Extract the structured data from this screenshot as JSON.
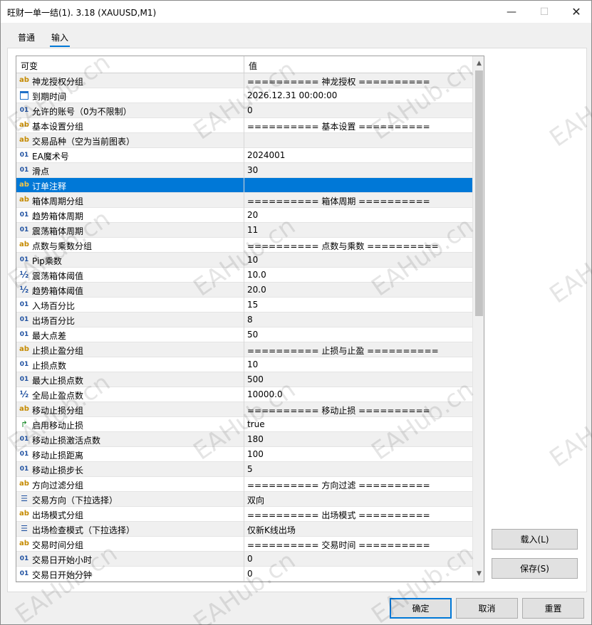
{
  "window": {
    "title": "旺财一单一结(1). 3.18 (XAUUSD,M1)",
    "minimize_glyph": "—",
    "maximize_glyph": "☐",
    "close_glyph": "✕"
  },
  "tabs": [
    {
      "label": "普通",
      "active": false
    },
    {
      "label": "输入",
      "active": true
    }
  ],
  "grid": {
    "col_variable": "可变",
    "col_value": "值",
    "rows": [
      {
        "icon": "ab",
        "name": "神龙授权分组",
        "value": "========== 神龙授权 =========="
      },
      {
        "icon": "calendar",
        "name": "到期时间",
        "value": "2026.12.31 00:00:00"
      },
      {
        "icon": "01",
        "name": "允许的账号（0为不限制）",
        "value": "0"
      },
      {
        "icon": "ab",
        "name": "基本设置分组",
        "value": "========== 基本设置 =========="
      },
      {
        "icon": "ab",
        "name": "交易品种（空为当前图表）",
        "value": ""
      },
      {
        "icon": "01",
        "name": "EA魔术号",
        "value": "2024001"
      },
      {
        "icon": "01",
        "name": "滑点",
        "value": "30"
      },
      {
        "icon": "ab",
        "name": "订单注释",
        "value": "",
        "selected": true
      },
      {
        "icon": "ab",
        "name": "箱体周期分组",
        "value": "========== 箱体周期 =========="
      },
      {
        "icon": "01",
        "name": "趋势箱体周期",
        "value": "20"
      },
      {
        "icon": "01",
        "name": "震荡箱体周期",
        "value": "11"
      },
      {
        "icon": "ab",
        "name": "点数与乘数分组",
        "value": "========== 点数与乘数 =========="
      },
      {
        "icon": "01",
        "name": "Pip乘数",
        "value": "10"
      },
      {
        "icon": "half",
        "name": "震荡箱体阈值",
        "value": "10.0"
      },
      {
        "icon": "half",
        "name": "趋势箱体阈值",
        "value": "20.0"
      },
      {
        "icon": "01",
        "name": "入场百分比",
        "value": "15"
      },
      {
        "icon": "01",
        "name": "出场百分比",
        "value": "8"
      },
      {
        "icon": "01",
        "name": "最大点差",
        "value": "50"
      },
      {
        "icon": "ab",
        "name": "止损止盈分组",
        "value": "========== 止损与止盈 =========="
      },
      {
        "icon": "01",
        "name": "止损点数",
        "value": "10"
      },
      {
        "icon": "01",
        "name": "最大止损点数",
        "value": "500"
      },
      {
        "icon": "half",
        "name": "全局止盈点数",
        "value": "10000.0"
      },
      {
        "icon": "ab",
        "name": "移动止损分组",
        "value": "========== 移动止损 =========="
      },
      {
        "icon": "bool",
        "name": "启用移动止损",
        "value": "true"
      },
      {
        "icon": "01",
        "name": "移动止损激活点数",
        "value": "180"
      },
      {
        "icon": "01",
        "name": "移动止损距离",
        "value": "100"
      },
      {
        "icon": "01",
        "name": "移动止损步长",
        "value": "5"
      },
      {
        "icon": "ab",
        "name": "方向过滤分组",
        "value": "========== 方向过滤 =========="
      },
      {
        "icon": "list",
        "name": "交易方向（下拉选择）",
        "value": "双向"
      },
      {
        "icon": "ab",
        "name": "出场模式分组",
        "value": "========== 出场模式 =========="
      },
      {
        "icon": "list",
        "name": "出场检查模式（下拉选择）",
        "value": "仅新K线出场"
      },
      {
        "icon": "ab",
        "name": "交易时间分组",
        "value": "========== 交易时间 =========="
      },
      {
        "icon": "01",
        "name": "交易日开始小时",
        "value": "0"
      },
      {
        "icon": "01",
        "name": "交易日开始分钟",
        "value": "0"
      }
    ]
  },
  "buttons": {
    "load": "载入(L)",
    "save": "保存(S)",
    "ok": "确定",
    "cancel": "取消",
    "reset": "重置"
  },
  "watermark_text": "EAHub.cn",
  "colors": {
    "selection": "#0078d7",
    "accent": "#0078d7"
  }
}
